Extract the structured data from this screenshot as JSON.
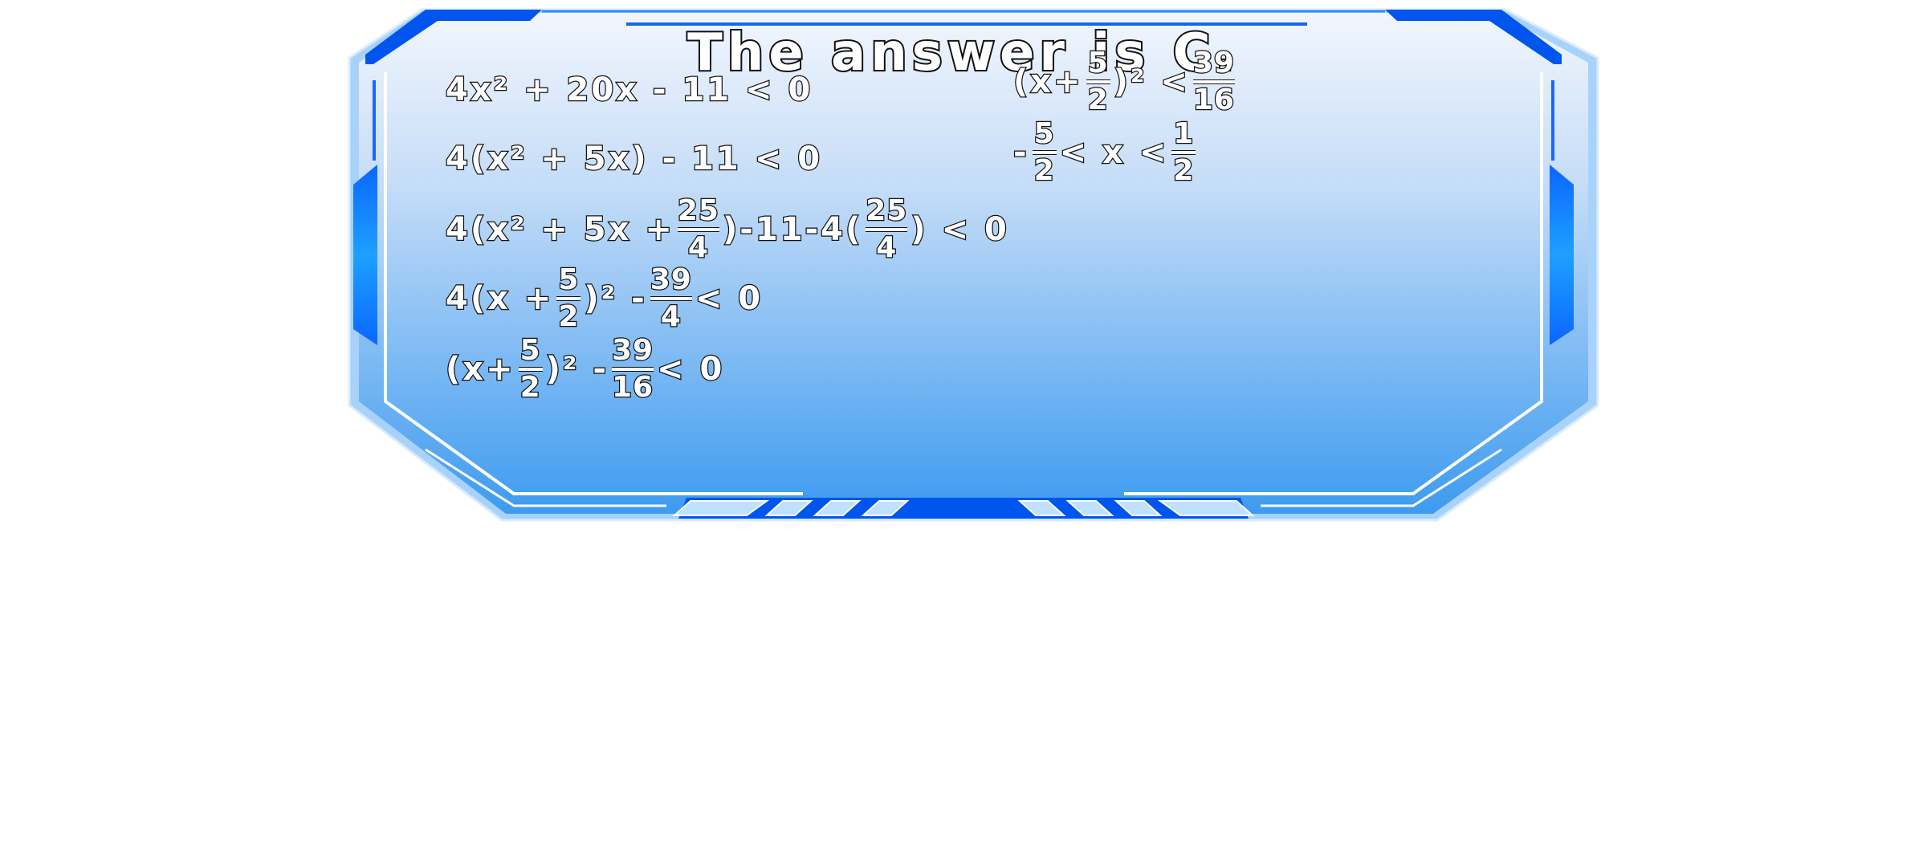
{
  "title": "The answer is C.",
  "colors": {
    "frame_dark": "#0055ee",
    "frame_mid": "#1e90ff",
    "frame_light": "#cfe6ff",
    "panel_top": "#f2f6fd",
    "panel_bottom": "#3d9bf0",
    "text_fill": "#ffffff",
    "text_stroke": "#111111"
  },
  "solution": {
    "left_steps": [
      {
        "parts": [
          {
            "t": "4x² + 20x - 11 < 0"
          }
        ]
      },
      {
        "parts": [
          {
            "t": "4(x² + 5x) - 11 < 0"
          }
        ]
      },
      {
        "parts": [
          {
            "t": "4(x² + 5x + "
          },
          {
            "num": "25",
            "den": "4"
          },
          {
            "t": ")-11-4("
          },
          {
            "num": "25",
            "den": "4"
          },
          {
            "t": ") < 0"
          }
        ]
      },
      {
        "parts": [
          {
            "t": "4(x + "
          },
          {
            "num": "5",
            "den": "2"
          },
          {
            "t": " )² - "
          },
          {
            "num": "39",
            "den": "4"
          },
          {
            "t": " < 0"
          }
        ]
      },
      {
        "parts": [
          {
            "t": "(x+"
          },
          {
            "num": "5",
            "den": "2"
          },
          {
            "t": " )² - "
          },
          {
            "num": "39",
            "den": "16"
          },
          {
            "t": "< 0"
          }
        ]
      }
    ],
    "right_steps": [
      {
        "parts": [
          {
            "t": "(x+"
          },
          {
            "num": "5",
            "den": "2"
          },
          {
            "t": ")² < "
          },
          {
            "num": "39",
            "den": "16"
          }
        ]
      },
      {
        "parts": [
          {
            "t": "- "
          },
          {
            "num": "5",
            "den": "2"
          },
          {
            "t": "< x < "
          },
          {
            "num": "1",
            "den": "2"
          }
        ]
      }
    ]
  }
}
